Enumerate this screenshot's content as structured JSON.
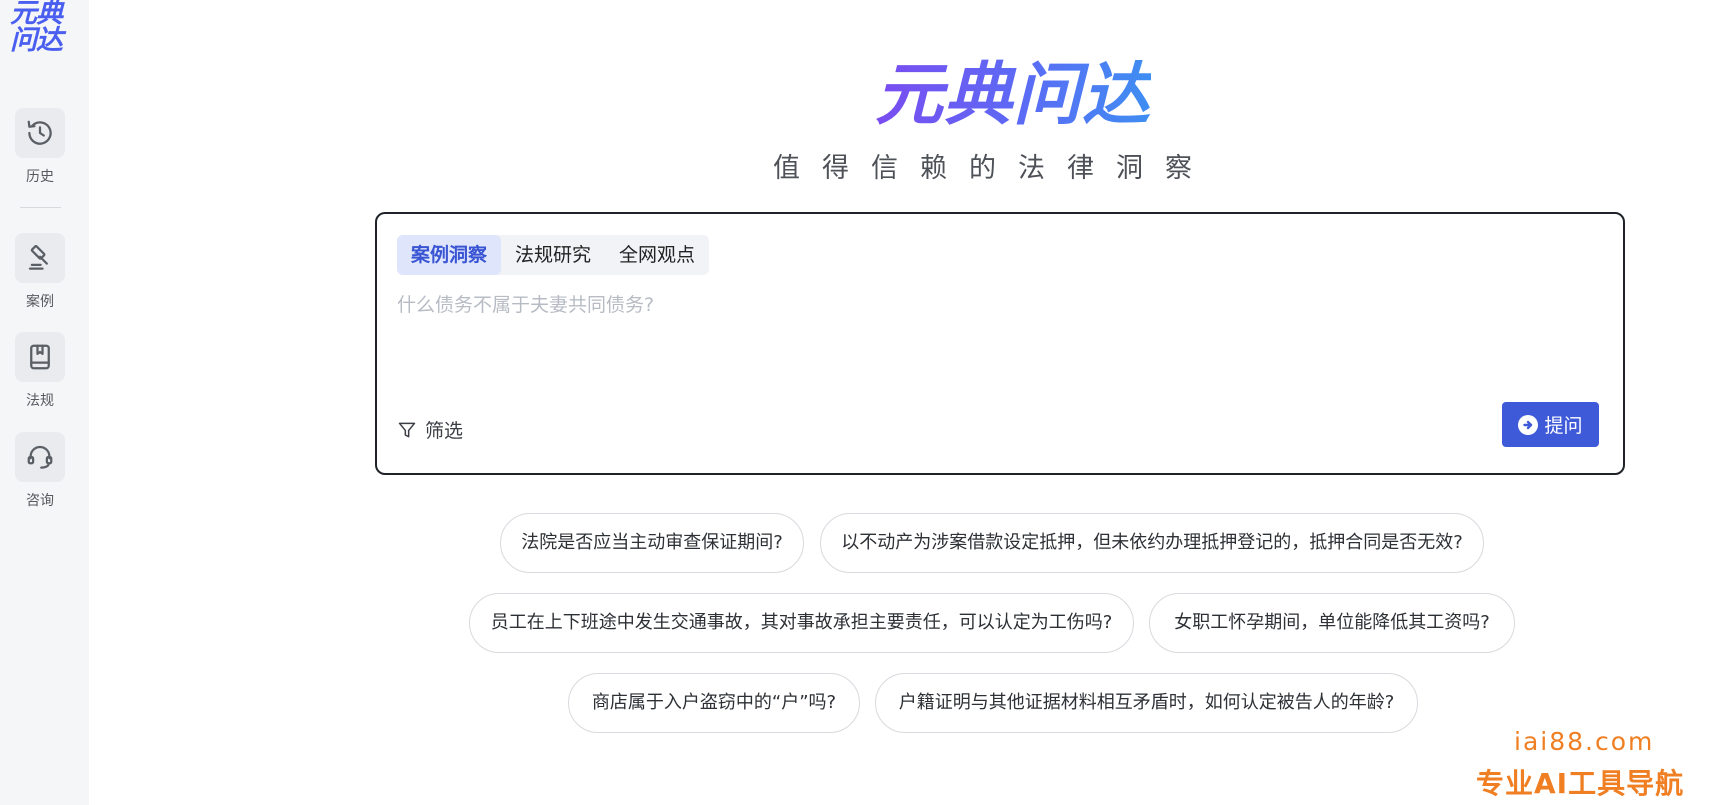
{
  "sidebar": {
    "logo": [
      "元典",
      "问达"
    ],
    "items": [
      {
        "label": "历史",
        "icon": "history-icon"
      },
      {
        "label": "案例",
        "icon": "gavel-icon"
      },
      {
        "label": "法规",
        "icon": "book-icon"
      },
      {
        "label": "咨询",
        "icon": "headset-icon"
      }
    ]
  },
  "hero": {
    "title": "元典问达",
    "subtitle": "值得信赖的法律洞察"
  },
  "search": {
    "tabs": [
      "案例洞察",
      "法规研究",
      "全网观点"
    ],
    "active_tab": "案例洞察",
    "placeholder": "什么债务不属于夫妻共同债务?",
    "value": "",
    "filter_label": "筛选",
    "ask_label": "提问"
  },
  "suggestions": [
    "法院是否应当主动审查保证期间?",
    "以不动产为涉案借款设定抵押，但未依约办理抵押登记的，抵押合同是否无效?",
    "员工在上下班途中发生交通事故，其对事故承担主要责任，可以认定为工伤吗?",
    "女职工怀孕期间，单位能降低其工资吗?",
    "商店属于入户盗窃中的“户”吗?",
    "户籍证明与其他证据材料相互矛盾时，如何认定被告人的年龄?"
  ],
  "watermark": {
    "line1": "iai88.com",
    "line2": "专业AI工具导航"
  },
  "colors": {
    "accent": "#3f5ad8",
    "active_tab_bg": "#dfe5fb",
    "sidebar_bg": "#f5f6f8",
    "watermark": "#ef7f22"
  }
}
